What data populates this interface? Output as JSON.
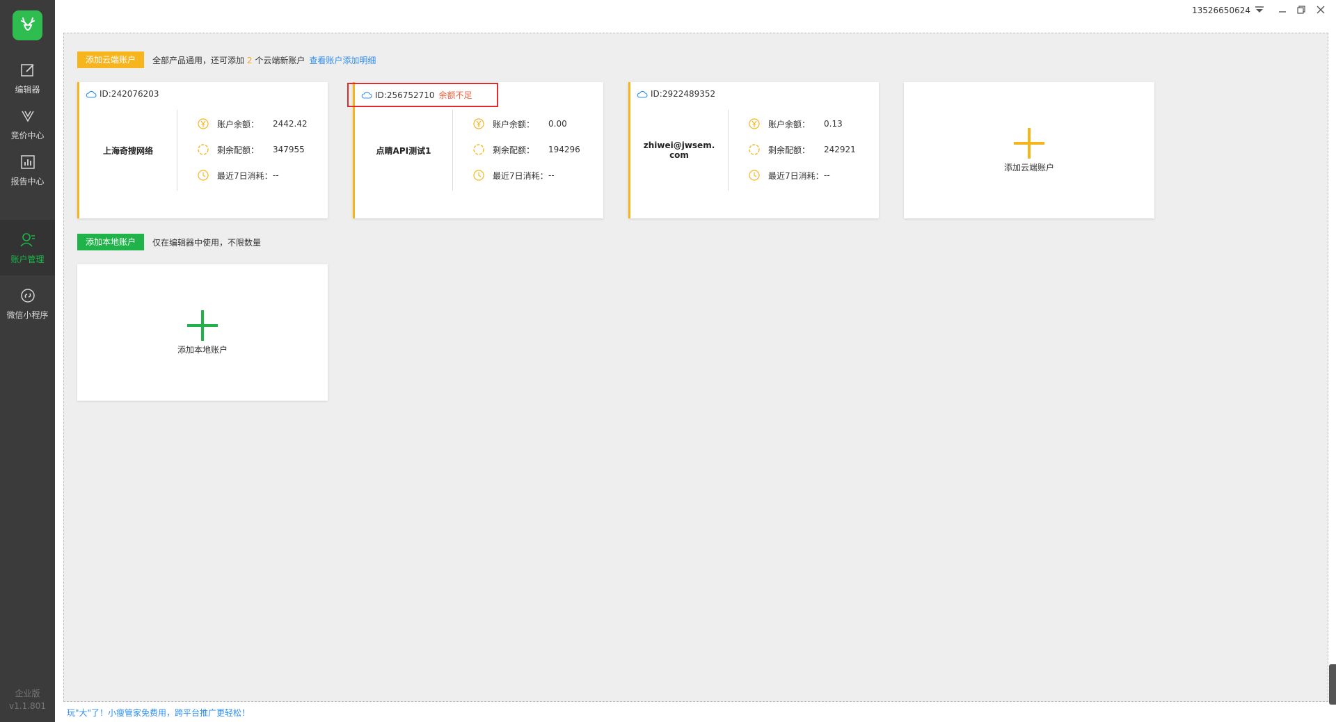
{
  "topbar": {
    "phone": "13526650624",
    "dropdown_icon": "triangle-down-icon",
    "minimize_icon": "minimize-icon",
    "restore_icon": "restore-icon",
    "close_icon": "close-icon"
  },
  "sidebar": {
    "items": [
      {
        "label": "编辑器",
        "icon": "edit-icon"
      },
      {
        "label": "竞价中心",
        "icon": "bid-icon"
      },
      {
        "label": "报告中心",
        "icon": "report-icon"
      },
      {
        "label": "账户管理",
        "icon": "user-icon",
        "active": true
      },
      {
        "label": "微信小程序",
        "icon": "miniprogram-icon"
      }
    ],
    "edition": "企业版",
    "version": "v1.1.801"
  },
  "cloud_section": {
    "button_label": "添加云端账户",
    "hint_before": "全部产品通用，还可添加",
    "hint_count": "2",
    "hint_after": "个云端新账户",
    "link_label": "查看账户添加明细"
  },
  "accounts": [
    {
      "id": "ID:242076203",
      "name": "上海奇搜网络",
      "balance_label": "账户余额：",
      "balance": "2442.42",
      "quota_label": "剩余配额：",
      "quota": "347955",
      "spend_label": "最近7日消耗：",
      "spend": "--",
      "warning": ""
    },
    {
      "id": "ID:256752710",
      "name": "点睛API测试1",
      "balance_label": "账户余额：",
      "balance": "0.00",
      "quota_label": "剩余配额：",
      "quota": "194296",
      "spend_label": "最近7日消耗：",
      "spend": "--",
      "warning": "余额不足"
    },
    {
      "id": "ID:2922489352",
      "name": "zhiwei@jwsem.com",
      "balance_label": "账户余额：",
      "balance": "0.13",
      "quota_label": "剩余配额：",
      "quota": "242921",
      "spend_label": "最近7日消耗：",
      "spend": "--",
      "warning": ""
    }
  ],
  "add_cloud_card_label": "添加云端账户",
  "local_section": {
    "button_label": "添加本地账户",
    "hint": "仅在编辑器中使用，不限数量"
  },
  "add_local_card_label": "添加本地账户",
  "footer_text": "玩\"大\"了！小瘦管家免费用，跨平台推广更轻松！",
  "colors": {
    "sidebar_bg": "#3b3b3b",
    "accent_green": "#1fb34a",
    "accent_orange": "#f7b51d",
    "link_blue": "#2f8ef0",
    "warning_red": "#f0623f"
  }
}
